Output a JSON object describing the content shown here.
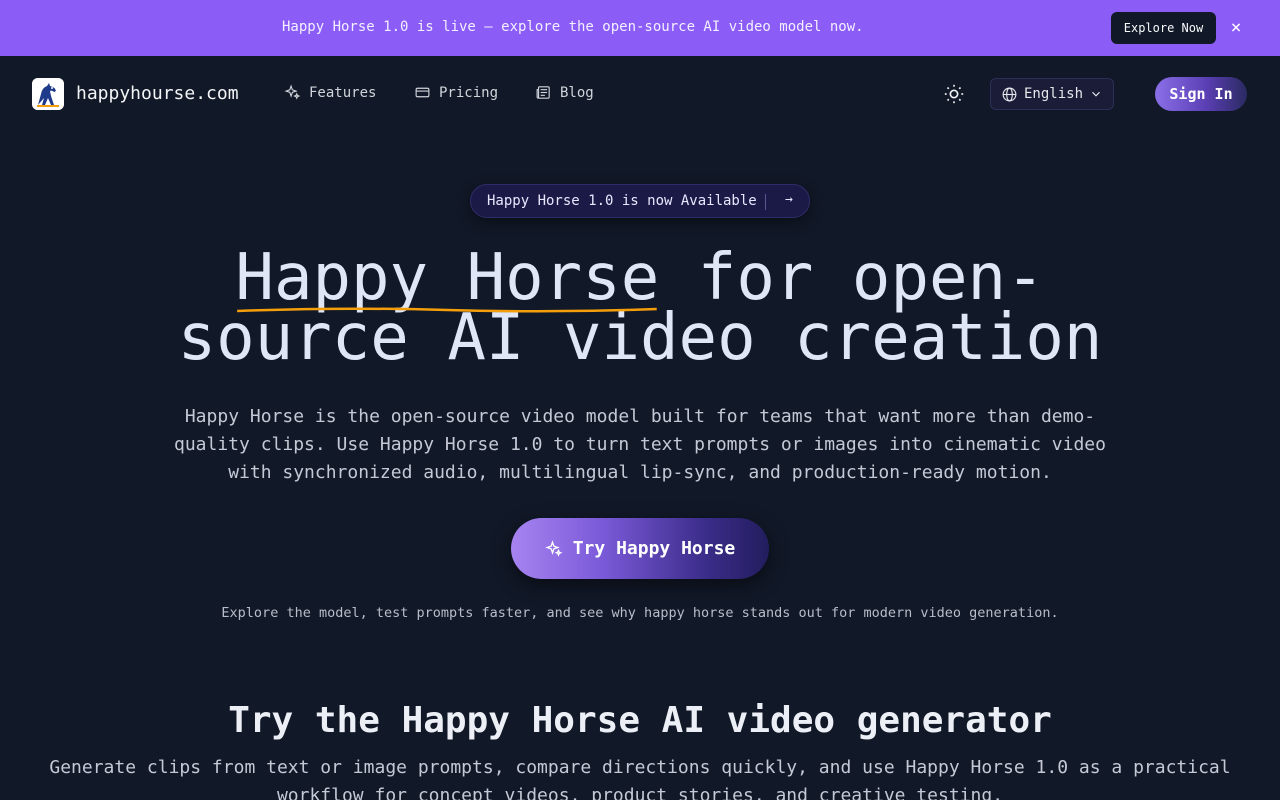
{
  "banner": {
    "text": "Happy Horse 1.0 is live — explore the open-source AI video model now.",
    "button_label": "Explore Now",
    "close_symbol": "×",
    "background": "#8b5cf6"
  },
  "nav": {
    "logo_icon": "horse-logo-icon",
    "site_name": "happyhourse.com",
    "links": [
      {
        "label": "Features",
        "icon": "sparkles-icon"
      },
      {
        "label": "Pricing",
        "icon": "credit-card-icon"
      },
      {
        "label": "Blog",
        "icon": "newspaper-icon"
      }
    ],
    "theme_icon": "sun-icon",
    "language": "English",
    "sign_in_label": "Sign In"
  },
  "hero": {
    "pill_text": "Happy Horse 1.0 is now Available",
    "pill_arrow": "→",
    "title_highlight": "Happy Horse",
    "title_line1_rest": " for open-",
    "title_line2": "source AI video creation",
    "subtitle": "Happy Horse is the open-source video model built for teams that want more than demo-quality clips. Use Happy Horse 1.0 to turn text prompts or images into cinematic video with synchronized audio, multilingual lip-sync, and production-ready motion.",
    "cta_label": "Try Happy Horse",
    "note": "Explore the model, test prompts faster, and see why happy horse stands out for modern video generation.",
    "underline_color": "#f59e0b"
  },
  "section": {
    "title": "Try the Happy Horse AI video generator",
    "subtitle": "Generate clips from text or image prompts, compare directions quickly, and use Happy Horse 1.0 as a practical workflow for concept videos, product stories, and creative testing."
  },
  "colors": {
    "page_background": "#111827",
    "accent": "#8b5cf6"
  }
}
